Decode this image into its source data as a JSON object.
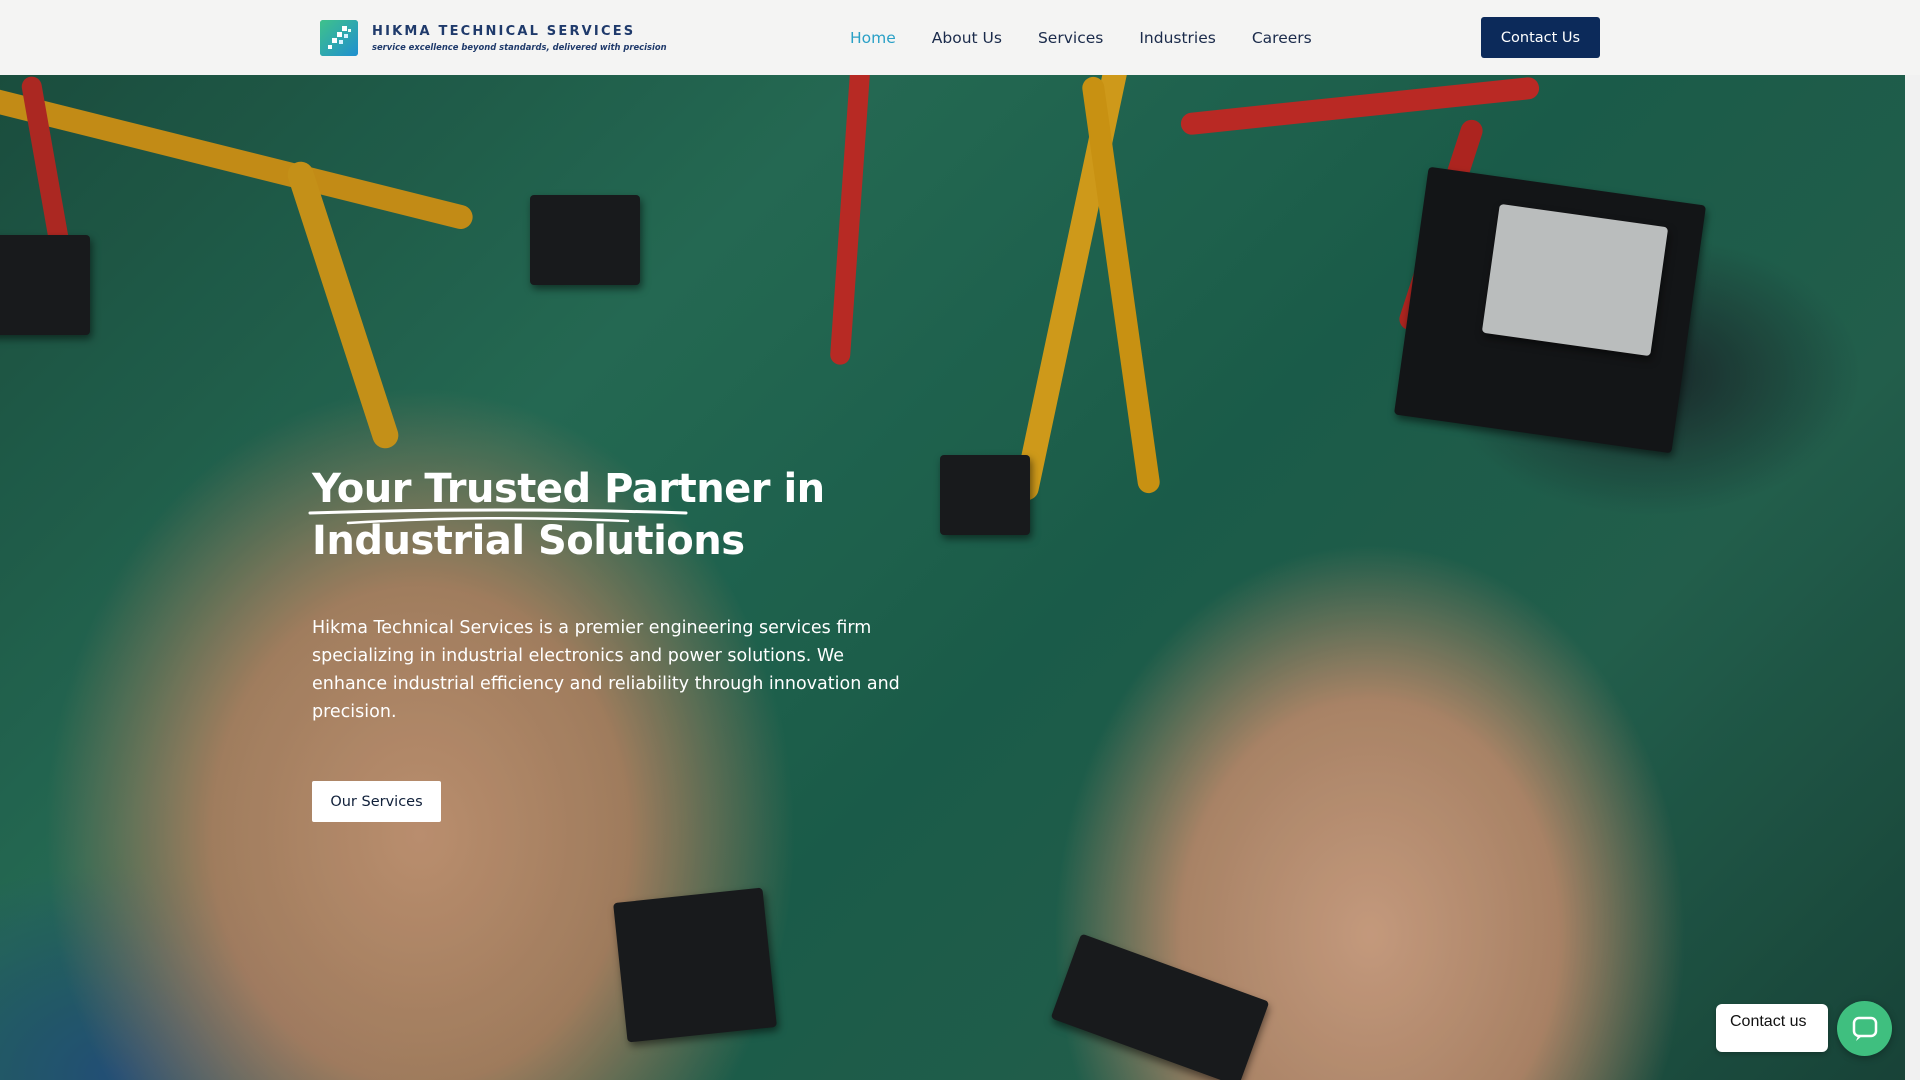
{
  "header": {
    "logo_title": "HIKMA TECHNICAL SERVICES",
    "logo_tagline": "service excellence beyond standards, delivered with precision",
    "nav": [
      {
        "label": "Home",
        "active": true
      },
      {
        "label": "About Us",
        "active": false
      },
      {
        "label": "Services",
        "active": false
      },
      {
        "label": "Industries",
        "active": false
      },
      {
        "label": "Careers",
        "active": false
      }
    ],
    "contact_label": "Contact Us"
  },
  "hero": {
    "title_highlight": "Your Trusted Partner",
    "title_rest": " in Industrial Solutions",
    "description": "Hikma Technical Services is a premier engineering services firm specializing in industrial electronics and power solutions. We enhance industrial efficiency and reliability through innovation and precision.",
    "button_label": "Our Services"
  },
  "chat_widget": {
    "bubble_text": "Contact us"
  },
  "colors": {
    "nav_active": "#2aa0c6",
    "brand_navy": "#0c2a5a",
    "chat_green": "#3fbf7f"
  }
}
